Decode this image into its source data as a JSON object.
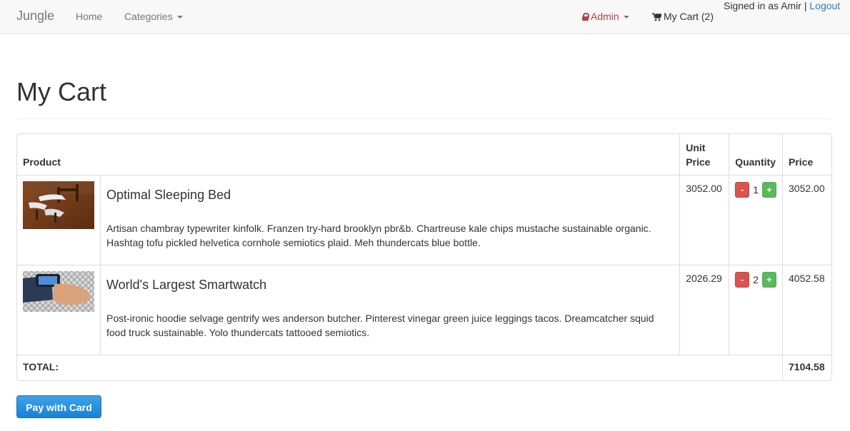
{
  "nav": {
    "brand": "Jungle",
    "home": "Home",
    "categories": "Categories",
    "admin": "Admin",
    "cart": "My Cart (2)",
    "signed_in": "Signed in as Amir",
    "separator": "|",
    "logout": "Logout"
  },
  "page": {
    "title": "My Cart"
  },
  "table": {
    "headers": {
      "product": "Product",
      "unit_price_1": "Unit",
      "unit_price_2": "Price",
      "quantity": "Quantity",
      "price": "Price"
    },
    "rows": [
      {
        "name": "Optimal Sleeping Bed",
        "description": "Artisan chambray typewriter kinfolk. Franzen try-hard brooklyn pbr&b. Chartreuse kale chips mustache sustainable organic. Hashtag tofu pickled helvetica cornhole semiotics plaid. Meh thundercats blue bottle.",
        "unit_price": "3052.00",
        "quantity": "1",
        "price": "3052.00"
      },
      {
        "name": "World's Largest Smartwatch",
        "description": "Post-ironic hoodie selvage gentrify wes anderson butcher. Pinterest vinegar green juice leggings tacos. Dreamcatcher squid food truck sustainable. Yolo thundercats tattooed semiotics.",
        "unit_price": "2026.29",
        "quantity": "2",
        "price": "4052.58"
      }
    ],
    "minus_label": "-",
    "plus_label": "+",
    "total_label": "TOTAL:",
    "total_value": "7104.58"
  },
  "pay_button": "Pay with Card",
  "colors": {
    "admin": "#a94442",
    "link": "#337ab7",
    "minus": "#d9534f",
    "plus": "#5cb85c",
    "pay": "#1a7fd6"
  }
}
